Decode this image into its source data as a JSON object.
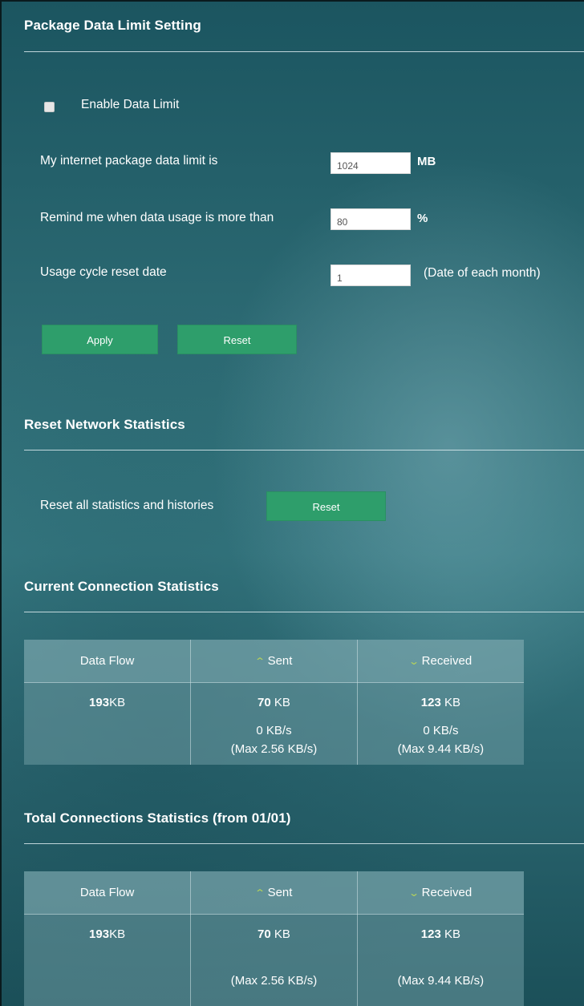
{
  "package_limit": {
    "title": "Package Data Limit Setting",
    "enable_label": "Enable Data Limit",
    "enabled": false,
    "limit_label": "My internet package data limit is",
    "limit_value": "1024",
    "limit_unit": "MB",
    "remind_label": "Remind me when data usage is more than",
    "remind_value": "80",
    "remind_unit": "%",
    "cycle_label": "Usage cycle reset date",
    "cycle_value": "1",
    "cycle_unit": "(Date of each month)",
    "apply_label": "Apply",
    "reset_label": "Reset"
  },
  "reset_network": {
    "title": "Reset Network Statistics",
    "label": "Reset all statistics and histories",
    "reset_label": "Reset"
  },
  "current_stats": {
    "title": "Current Connection Statistics",
    "headers": {
      "data_flow": "Data Flow",
      "sent": "Sent",
      "received": "Received"
    },
    "data_flow": {
      "value": "193",
      "unit": "KB"
    },
    "sent": {
      "value": "70",
      "unit": " KB",
      "rate": "0 KB/s",
      "max": "(Max 2.56 KB/s)"
    },
    "received": {
      "value": "123",
      "unit": " KB",
      "rate": "0 KB/s",
      "max": "(Max 9.44 KB/s)"
    }
  },
  "total_stats": {
    "title": "Total Connections Statistics (from 01/01)",
    "headers": {
      "data_flow": "Data Flow",
      "sent": "Sent",
      "received": "Received"
    },
    "data_flow": {
      "value": "193",
      "unit": "KB"
    },
    "sent": {
      "value": "70",
      "unit": " KB",
      "max": "(Max 2.56 KB/s)"
    },
    "received": {
      "value": "123",
      "unit": " KB",
      "max": "(Max 9.44 KB/s)"
    }
  },
  "icons": {
    "sent": "chevron-up-icon",
    "received": "chevron-down-icon"
  },
  "colors": {
    "accent_button": "#2e9e6b",
    "arrow": "#b6d35a"
  }
}
